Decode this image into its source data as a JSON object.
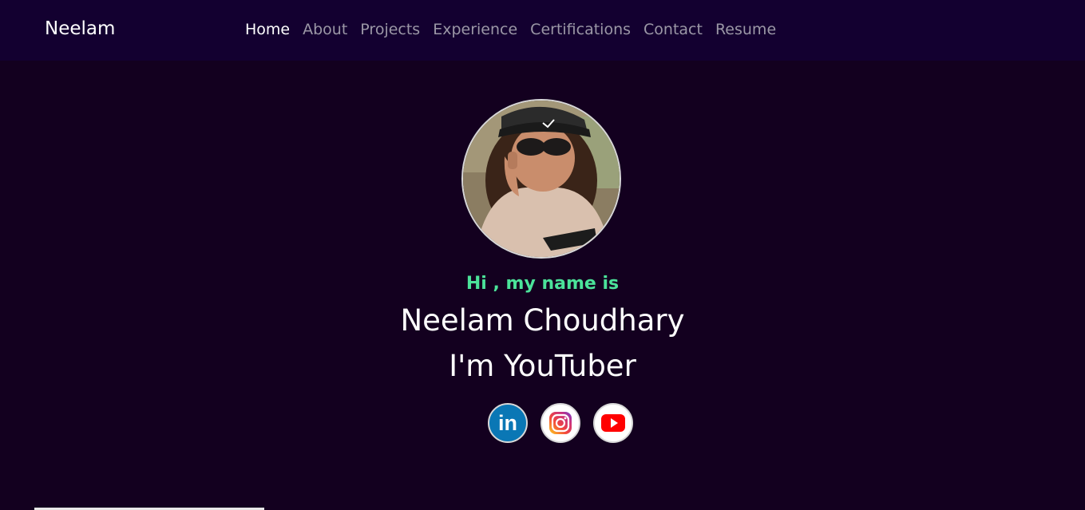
{
  "brand": "Neelam",
  "nav": [
    "Home",
    "About",
    "Projects",
    "Experience",
    "Certifications",
    "Contact",
    "Resume"
  ],
  "hero": {
    "greeting": "Hi , my name is",
    "name": "Neelam Choudhary",
    "role_line": "I'm YouTuber"
  },
  "socials": {
    "linkedin_text": "in",
    "icons": [
      "linkedin-icon",
      "instagram-icon",
      "youtube-icon"
    ]
  },
  "colors": {
    "background": "#13001f",
    "navbar": "#130030",
    "accent": "#4be39a",
    "nav_muted": "#9b97a6"
  }
}
